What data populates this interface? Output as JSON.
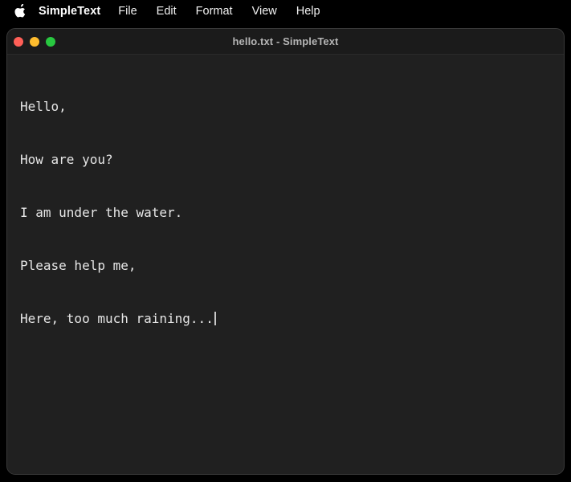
{
  "menubar": {
    "apple_icon": "apple-logo-icon",
    "app_name": "SimpleText",
    "items": [
      {
        "label": "File"
      },
      {
        "label": "Edit"
      },
      {
        "label": "Format"
      },
      {
        "label": "View"
      },
      {
        "label": "Help"
      }
    ]
  },
  "window": {
    "title": "hello.txt - SimpleText",
    "traffic_lights": [
      {
        "name": "close-button",
        "color": "#ff5f57"
      },
      {
        "name": "minimize-button",
        "color": "#febc2e"
      },
      {
        "name": "maximize-button",
        "color": "#28c840"
      }
    ],
    "editor": {
      "lines": [
        "Hello,",
        "How are you?",
        "I am under the water.",
        "Please help me,",
        "Here, too much raining..."
      ],
      "caret_line_index": 4,
      "text_color": "#e6e6e6",
      "background_color": "#202020"
    }
  },
  "desktop": {
    "background_color": "#000000"
  }
}
